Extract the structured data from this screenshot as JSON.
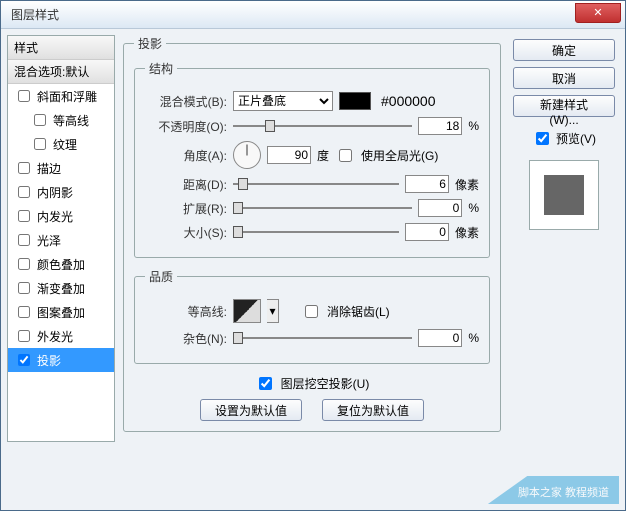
{
  "title": "图层样式",
  "left": {
    "header": "样式",
    "blendHeader": "混合选项:默认",
    "items": [
      {
        "label": "斜面和浮雕",
        "checked": false,
        "sub": false
      },
      {
        "label": "等高线",
        "checked": false,
        "sub": true
      },
      {
        "label": "纹理",
        "checked": false,
        "sub": true
      },
      {
        "label": "描边",
        "checked": false,
        "sub": false
      },
      {
        "label": "内阴影",
        "checked": false,
        "sub": false
      },
      {
        "label": "内发光",
        "checked": false,
        "sub": false
      },
      {
        "label": "光泽",
        "checked": false,
        "sub": false
      },
      {
        "label": "颜色叠加",
        "checked": false,
        "sub": false
      },
      {
        "label": "渐变叠加",
        "checked": false,
        "sub": false
      },
      {
        "label": "图案叠加",
        "checked": false,
        "sub": false
      },
      {
        "label": "外发光",
        "checked": false,
        "sub": false
      },
      {
        "label": "投影",
        "checked": true,
        "sub": false,
        "selected": true
      }
    ]
  },
  "panel": {
    "title": "投影",
    "structureLegend": "结构",
    "blendMode": {
      "label": "混合模式(B):",
      "value": "正片叠底",
      "colorHex": "#000000"
    },
    "opacity": {
      "label": "不透明度(O):",
      "value": "18",
      "unit": "%",
      "thumbPct": 18
    },
    "angle": {
      "label": "角度(A):",
      "value": "90",
      "unit": "度",
      "globalLabel": "使用全局光(G)",
      "globalChecked": false
    },
    "distance": {
      "label": "距离(D):",
      "value": "6",
      "unit": "像素",
      "thumbPct": 3
    },
    "spread": {
      "label": "扩展(R):",
      "value": "0",
      "unit": "%",
      "thumbPct": 0
    },
    "size": {
      "label": "大小(S):",
      "value": "0",
      "unit": "像素",
      "thumbPct": 0
    },
    "qualityLegend": "品质",
    "contour": {
      "label": "等高线:",
      "antiAliasLabel": "消除锯齿(L)",
      "antiAliasChecked": false
    },
    "noise": {
      "label": "杂色(N):",
      "value": "0",
      "unit": "%",
      "thumbPct": 0
    },
    "knockout": {
      "label": "图层挖空投影(U)",
      "checked": true
    },
    "defaultsBtn": "设置为默认值",
    "resetBtn": "复位为默认值"
  },
  "right": {
    "ok": "确定",
    "cancel": "取消",
    "newStyle": "新建样式(W)...",
    "previewLabel": "预览(V)",
    "previewChecked": true
  },
  "watermark": "脚本之家 教程频道"
}
